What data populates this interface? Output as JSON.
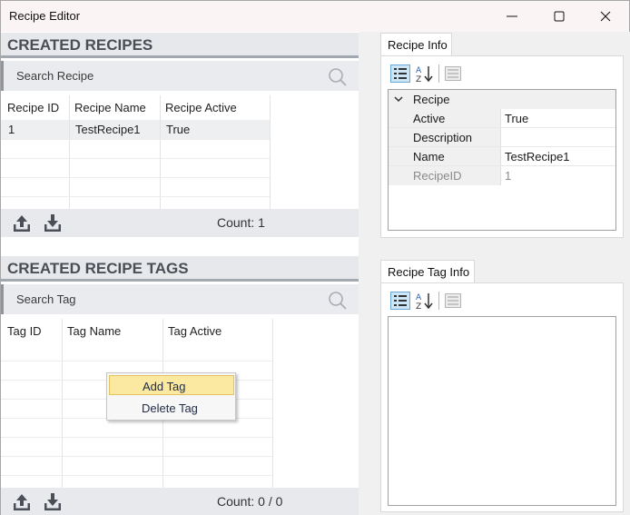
{
  "window": {
    "title": "Recipe Editor"
  },
  "recipes": {
    "header": "CREATED RECIPES",
    "search_placeholder": "Search Recipe",
    "columns": [
      "Recipe ID",
      "Recipe Name",
      "Recipe Active"
    ],
    "rows": [
      {
        "id": "1",
        "name": "TestRecipe1",
        "active": "True"
      }
    ],
    "count_label": "Count: 1"
  },
  "tags": {
    "header": "CREATED RECIPE TAGS",
    "search_placeholder": "Search Tag",
    "columns": [
      "Tag ID",
      "Tag Name",
      "Tag Active"
    ],
    "count_label": "Count: 0 / 0"
  },
  "context_menu": {
    "items": [
      "Add Tag",
      "Delete Tag"
    ],
    "highlighted": "Add Tag"
  },
  "recipe_info": {
    "tab_label": "Recipe Info",
    "category": "Recipe",
    "properties": [
      {
        "key": "Active",
        "value": "True"
      },
      {
        "key": "Description",
        "value": ""
      },
      {
        "key": "Name",
        "value": "TestRecipe1"
      },
      {
        "key": "RecipeID",
        "value": "1"
      }
    ]
  },
  "recipe_tag_info": {
    "tab_label": "Recipe Tag Info"
  },
  "colors": {
    "accent_highlight": "#fbe9a1",
    "header_bg": "#e6e8ec",
    "selected_row": "#eeeff1"
  },
  "icons": [
    "minimize-icon",
    "maximize-icon",
    "close-icon",
    "search-icon",
    "upload-icon",
    "download-icon",
    "categorized-icon",
    "sort-alpha-icon",
    "property-pages-icon",
    "collapse-arrow-icon"
  ]
}
